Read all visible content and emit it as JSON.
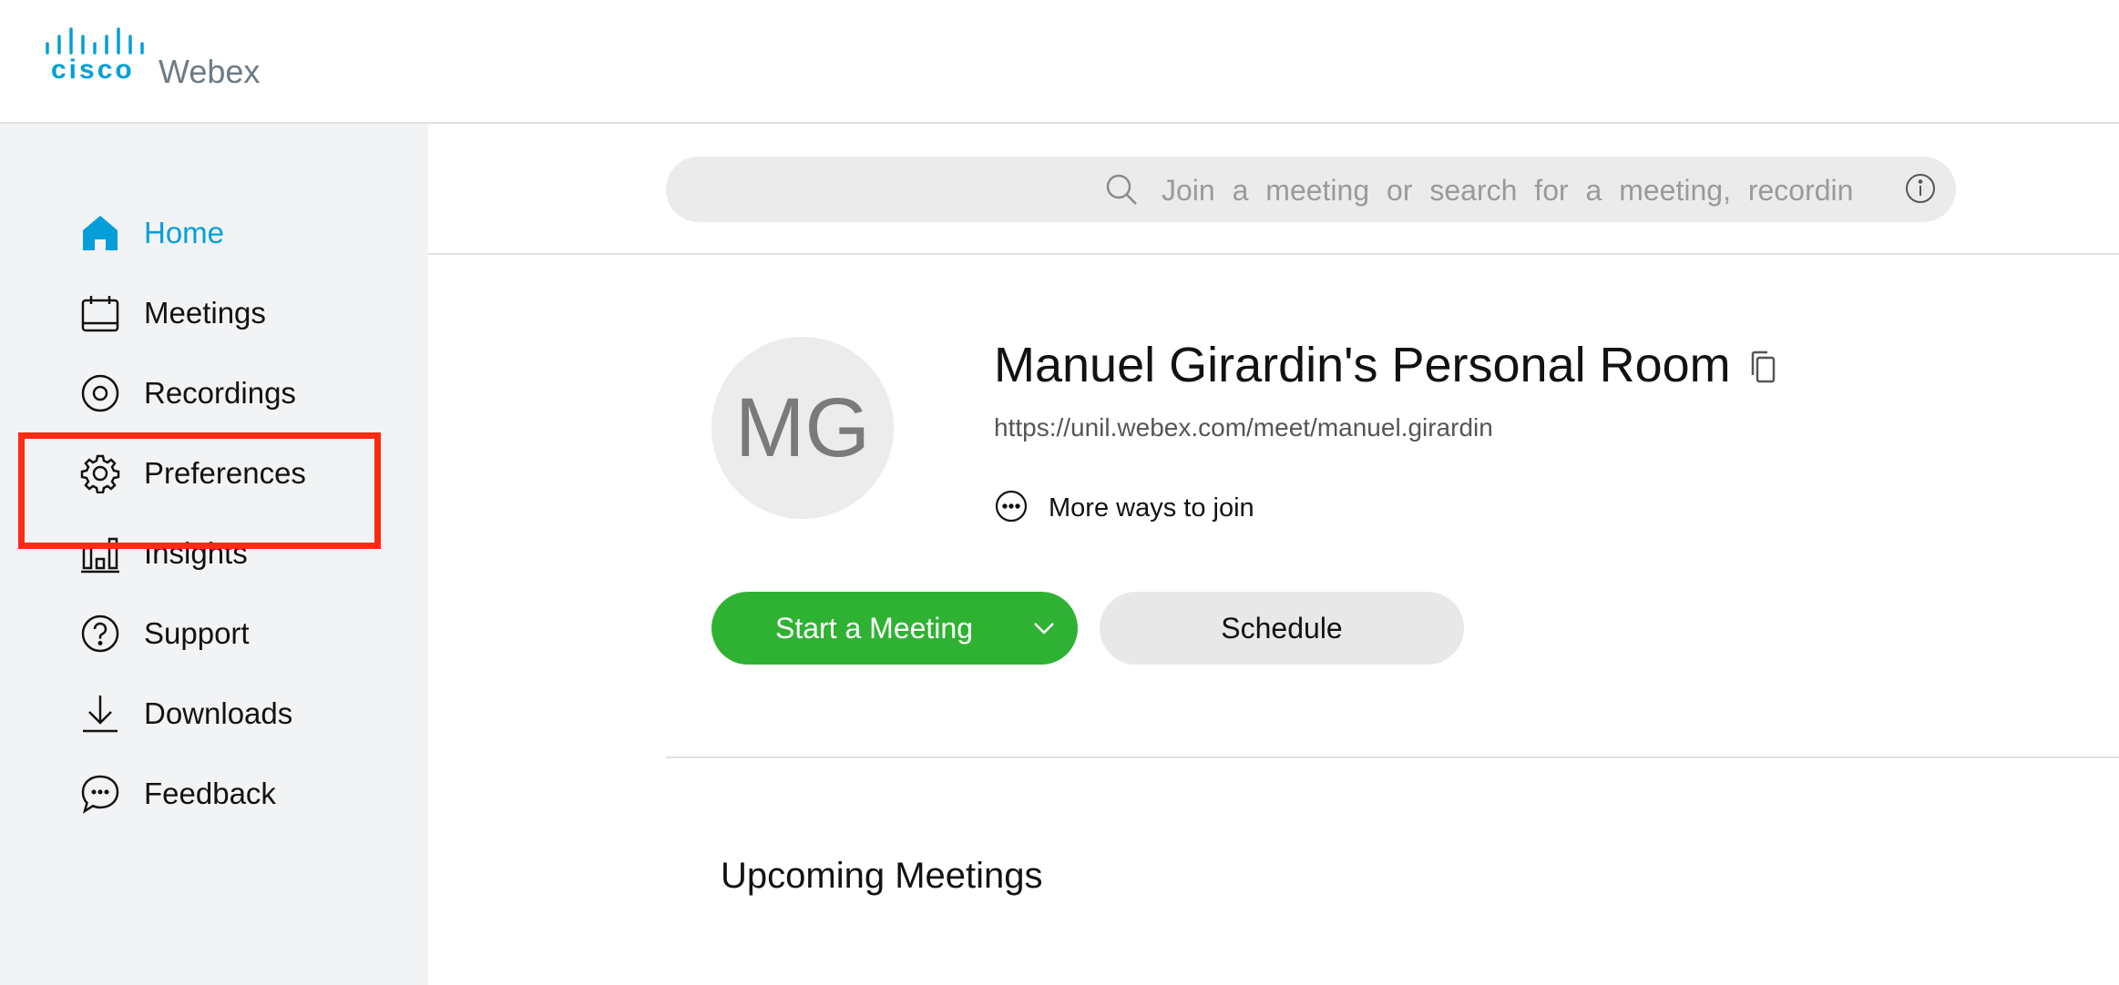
{
  "brand": {
    "company": "cisco",
    "product": "Webex",
    "accent": "#049fd9"
  },
  "sidebar": {
    "items": [
      {
        "label": "Home",
        "icon": "home-icon",
        "active": true
      },
      {
        "label": "Meetings",
        "icon": "calendar-icon",
        "active": false
      },
      {
        "label": "Recordings",
        "icon": "recording-icon",
        "active": false
      },
      {
        "label": "Preferences",
        "icon": "gear-icon",
        "active": false
      },
      {
        "label": "Insights",
        "icon": "bar-chart-icon",
        "active": false
      },
      {
        "label": "Support",
        "icon": "question-icon",
        "active": false
      },
      {
        "label": "Downloads",
        "icon": "download-icon",
        "active": false
      },
      {
        "label": "Feedback",
        "icon": "chat-bubble-icon",
        "active": false
      }
    ],
    "highlight_color": "#ff2a12"
  },
  "search": {
    "placeholder": "Join a meeting or search for a meeting, recording, or transcript",
    "value": ""
  },
  "room": {
    "initials": "MG",
    "title": "Manuel Girardin's Personal Room",
    "url": "https://unil.webex.com/meet/manuel.girardin",
    "more_ways": "More ways to join"
  },
  "actions": {
    "start_label": "Start a Meeting",
    "start_color": "#2fb233",
    "schedule_label": "Schedule"
  },
  "upcoming": {
    "heading": "Upcoming Meetings"
  }
}
